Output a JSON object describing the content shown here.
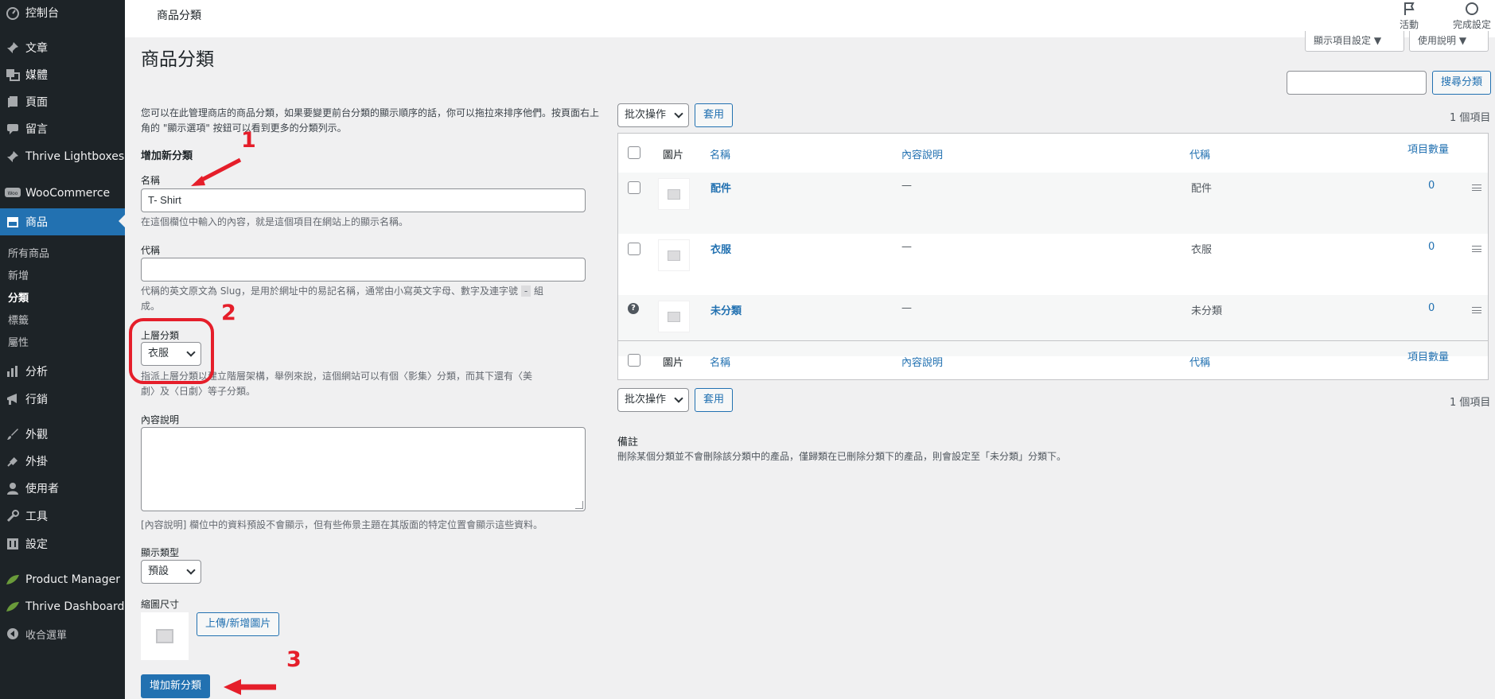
{
  "sidebar": {
    "items": [
      {
        "label": "控制台",
        "icon": "dashboard-icon"
      },
      {
        "label": "文章",
        "icon": "pushpin-icon"
      },
      {
        "label": "媒體",
        "icon": "media-icon"
      },
      {
        "label": "頁面",
        "icon": "page-icon"
      },
      {
        "label": "留言",
        "icon": "comment-icon"
      },
      {
        "label": "Thrive Lightboxes",
        "icon": "pushpin-icon"
      },
      {
        "label": "WooCommerce",
        "icon": "woo-icon"
      },
      {
        "label": "商品",
        "icon": "archive-icon"
      },
      {
        "label": "分析",
        "icon": "bar-chart-icon"
      },
      {
        "label": "行銷",
        "icon": "megaphone-icon"
      },
      {
        "label": "外觀",
        "icon": "brush-icon"
      },
      {
        "label": "外掛",
        "icon": "plugin-icon"
      },
      {
        "label": "使用者",
        "icon": "user-icon"
      },
      {
        "label": "工具",
        "icon": "wrench-icon"
      },
      {
        "label": "設定",
        "icon": "settings-icon"
      },
      {
        "label": "Product Manager",
        "icon": "leaf-icon"
      },
      {
        "label": "Thrive Dashboard",
        "icon": "leaf-icon"
      },
      {
        "label": "收合選單",
        "icon": "collapse-icon"
      }
    ],
    "submenu": [
      "所有商品",
      "新增",
      "分類",
      "標籤",
      "屬性"
    ]
  },
  "topbar": {
    "title": "商品分類",
    "activity_label": "活動",
    "finish_setup_label": "完成設定",
    "screen_options_label": "顯示項目設定 ▼",
    "help_label": "使用說明 ▼"
  },
  "page": {
    "title": "商品分類"
  },
  "form": {
    "intro": "您可以在此管理商店的商品分類，如果要變更前台分類的顯示順序的話，你可以拖拉來排序他們。按頁面右上角的 \"顯示選項\" 按鈕可以看到更多的分類列示。",
    "section_title": "增加新分類",
    "name_label": "名稱",
    "name_value": "T- Shirt",
    "name_help": "在這個欄位中輸入的內容，就是這個項目在網站上的顯示名稱。",
    "slug_label": "代稱",
    "slug_value": "",
    "slug_help_a": "代稱的英文原文為 Slug，是用於網址中的易記名稱，通常由小寫英文字母、數字及連字號",
    "slug_help_code": "-",
    "slug_help_b": "組",
    "slug_help_c": "成。",
    "parent_label": "上層分類",
    "parent_value": "衣服",
    "parent_help_1": "指派上層分類以建立階層架構，舉例來說，這個網站可以有個〈影集〉分類，而其下還有〈美",
    "parent_help_2": "劇〉及〈日劇〉等子分類。",
    "desc_label": "內容說明",
    "desc_help": "[內容說明] 欄位中的資料預設不會顯示，但有些佈景主題在其版面的特定位置會顯示這些資料。",
    "display_type_label": "顯示類型",
    "display_type_value": "預設",
    "thumbnail_label": "縮圖尺寸",
    "upload_button": "上傳/新增圖片",
    "submit_button": "增加新分類"
  },
  "annotations": [
    "1",
    "2",
    "3"
  ],
  "table": {
    "search_button": "搜尋分類",
    "bulk_action": "批次操作",
    "apply_button": "套用",
    "item_count": "1 個項目",
    "columns": {
      "image": "圖片",
      "name": "名稱",
      "description": "內容說明",
      "slug": "代稱",
      "count": "項目數量"
    },
    "rows": [
      {
        "name": "配件",
        "description": "—",
        "slug": "配件",
        "count": "0"
      },
      {
        "name": "衣服",
        "description": "—",
        "slug": "衣服",
        "count": "0"
      },
      {
        "name": "未分類",
        "description": "—",
        "slug": "未分類",
        "count": "0"
      }
    ]
  },
  "notes": {
    "title": "備註",
    "body": "刪除某個分類並不會刪除該分類中的產品，僅歸類在已刪除分類下的產品，則會設定至「未分類」分類下。"
  },
  "colors": {
    "accent": "#2271b1",
    "sidebar_bg": "#1d2327",
    "annotation_red": "#e51e2a"
  }
}
